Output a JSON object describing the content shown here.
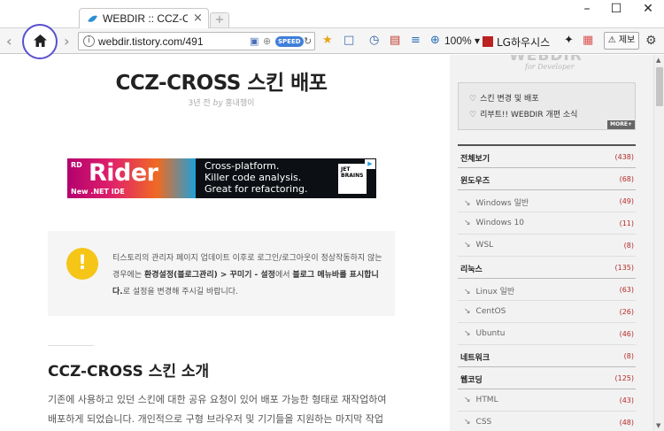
{
  "tab": {
    "title": "WEBDIR :: CCZ-CR",
    "close": "×",
    "new": "+"
  },
  "window": {
    "minimize": "–",
    "maximize": "☐",
    "close": "✕"
  },
  "toolbar": {
    "url": "webdir.tistory.com/491",
    "speed": "SPEED",
    "zoom": "100% ▾",
    "lg": "LG하우시스",
    "report": "⚠ 제보"
  },
  "post": {
    "title": "CCZ-CROSS 스킨 배포",
    "meta_time": "3년 전",
    "meta_by": "by",
    "meta_author": "홍내쟁이"
  },
  "ad": {
    "rd": "RD",
    "brand": "Rider",
    "sub": "New .NET IDE",
    "line1": "Cross-platform.",
    "line2": "Killer code analysis.",
    "line3": "Great for refactoring.",
    "jb": "JET BRAINS"
  },
  "notice": {
    "icon": "!",
    "part1": "티스토리의 관리자 페이지 업데이트 이후로 로그인/로그아웃이 정상작동하지 않는 경우에는 ",
    "bold1": "환경설정(블로그관리) > 꾸미기 - 설정",
    "part2": "에서 ",
    "bold2": "블로그 메뉴바를 표시합니다.",
    "part3": "로 설정을 변경해 주시길 바랍니다."
  },
  "section": {
    "heading": "CCZ-CROSS 스킨 소개",
    "body": "기존에 사용하고 있던 스킨에 대한 공유 요청이 있어 배포 가능한 형태로 재작업하여 배포하게 되었습니다. 개인적으로 구형 브라우저 및 기기들을 지원하는 마지막 작업 결과"
  },
  "sidebar": {
    "logo": "WEBDIR",
    "tagline": "for Developer",
    "notices": [
      "스킨 변경 및 배포",
      "리부트!! WEBDIR 개편 소식"
    ],
    "more": "MORE+",
    "categories": [
      {
        "name": "전체보기",
        "count": "(438)",
        "level": "top"
      },
      {
        "name": "윈도우즈",
        "count": "(68)",
        "level": "top"
      },
      {
        "name": "Windows 일반",
        "count": "(49)",
        "level": "sub"
      },
      {
        "name": "Windows 10",
        "count": "(11)",
        "level": "sub"
      },
      {
        "name": "WSL",
        "count": "(8)",
        "level": "sub"
      },
      {
        "name": "리눅스",
        "count": "(135)",
        "level": "top"
      },
      {
        "name": "Linux 일반",
        "count": "(63)",
        "level": "sub"
      },
      {
        "name": "CentOS",
        "count": "(26)",
        "level": "sub"
      },
      {
        "name": "Ubuntu",
        "count": "(46)",
        "level": "sub"
      },
      {
        "name": "네트워크",
        "count": "(8)",
        "level": "top"
      },
      {
        "name": "웹코딩",
        "count": "(125)",
        "level": "top"
      },
      {
        "name": "HTML",
        "count": "(43)",
        "level": "sub"
      },
      {
        "name": "CSS",
        "count": "(48)",
        "level": "sub"
      }
    ]
  }
}
